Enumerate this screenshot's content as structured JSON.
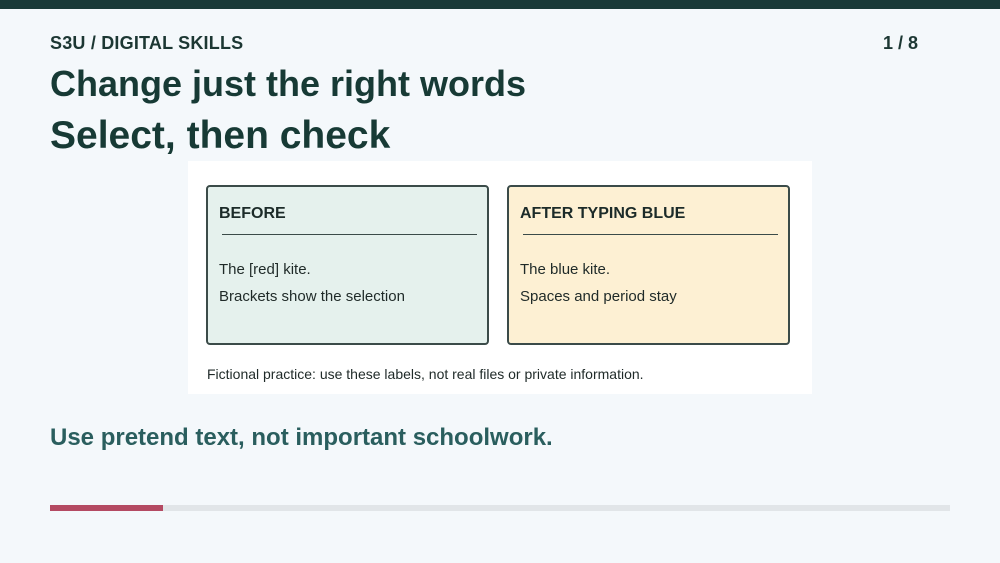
{
  "header": {
    "course": "S3U / DIGITAL SKILLS",
    "page_indicator": "1 / 8"
  },
  "slide": {
    "title": "Change just the right words",
    "subtitle": "Select, then check"
  },
  "cards": [
    {
      "heading": "BEFORE",
      "line1": "The [red] kite.",
      "line2": "Brackets show the selection",
      "background": "#e5f1ed"
    },
    {
      "heading": "AFTER TYPING BLUE",
      "line1": "The blue kite.",
      "line2": "Spaces and period stay",
      "background": "#fdf0d3"
    }
  ],
  "note": "Fictional practice: use these labels, not real files or private information.",
  "tip": "Use pretend text, not important schoolwork.",
  "progress": {
    "current": 1,
    "total": 8,
    "fraction": 0.125,
    "color": "#b44a62"
  },
  "theme": {
    "top_bar": "#1a3a38",
    "text": "#173a35",
    "tip_color": "#2a5e5e"
  }
}
